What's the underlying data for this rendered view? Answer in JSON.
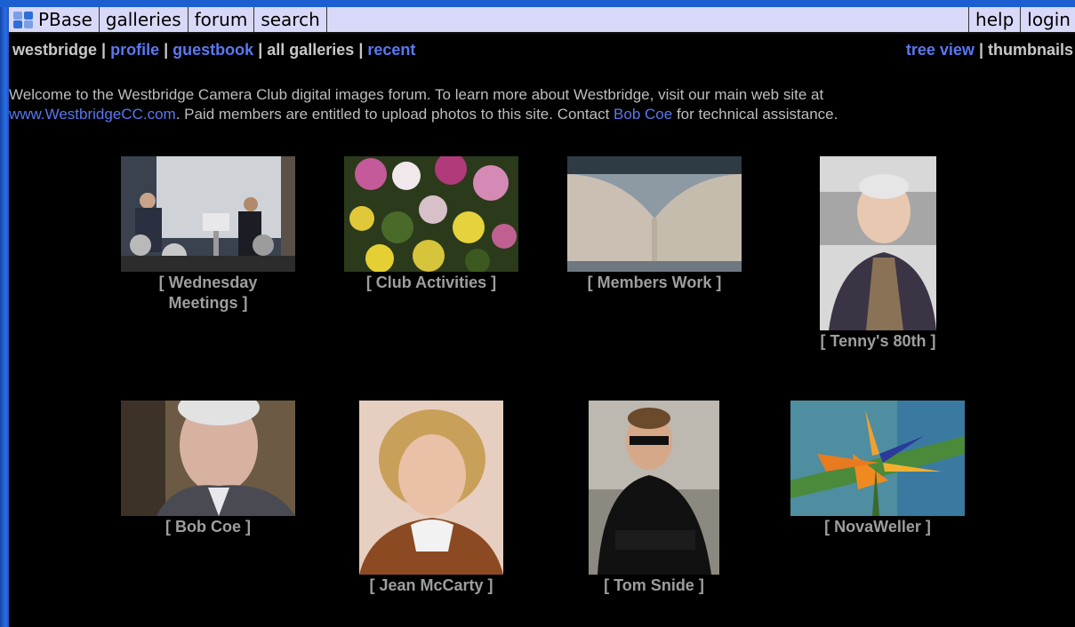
{
  "navbar": {
    "logo_text": "PBase",
    "items": [
      "galleries",
      "forum",
      "search"
    ],
    "right_items": [
      "help",
      "login"
    ]
  },
  "subnav": {
    "left": [
      "westbridge",
      "profile",
      "guestbook",
      "all galleries",
      "recent"
    ],
    "right": [
      "tree view",
      "thumbnails"
    ]
  },
  "intro": {
    "text1": "Welcome to the Westbridge Camera Club digital images forum. To learn more about Westbridge, visit our main web site at",
    "link_site": "www.WestbridgeCC.com",
    "text2": ". Paid members are entitled to upload photos to this site. Contact",
    "link_contact": "Bob Coe",
    "text3": "for technical assistance."
  },
  "galleries": [
    {
      "caption": "[ Wednesday Meetings ]",
      "image": "meeting-photo"
    },
    {
      "caption": "[ Club Activities ]",
      "image": "flowers-photo"
    },
    {
      "caption": "[ Members Work ]",
      "image": "open-book-photo"
    },
    {
      "caption": "[ Tenny's 80th ]",
      "image": "older-man-portrait"
    },
    {
      "caption": "[ Bob Coe ]",
      "image": "man-portrait"
    },
    {
      "caption": "[ Jean McCarty ]",
      "image": "woman-portrait"
    },
    {
      "caption": "[ Tom Snide ]",
      "image": "man-sunglasses-portrait"
    },
    {
      "caption": "[ NovaWeller ]",
      "image": "bird-of-paradise-photo"
    }
  ],
  "colors": {
    "frame": "#1b5fd0",
    "navbar": "#d8d8f8",
    "link": "#5a78f0",
    "text": "#bdbdbd",
    "background": "#000000"
  }
}
